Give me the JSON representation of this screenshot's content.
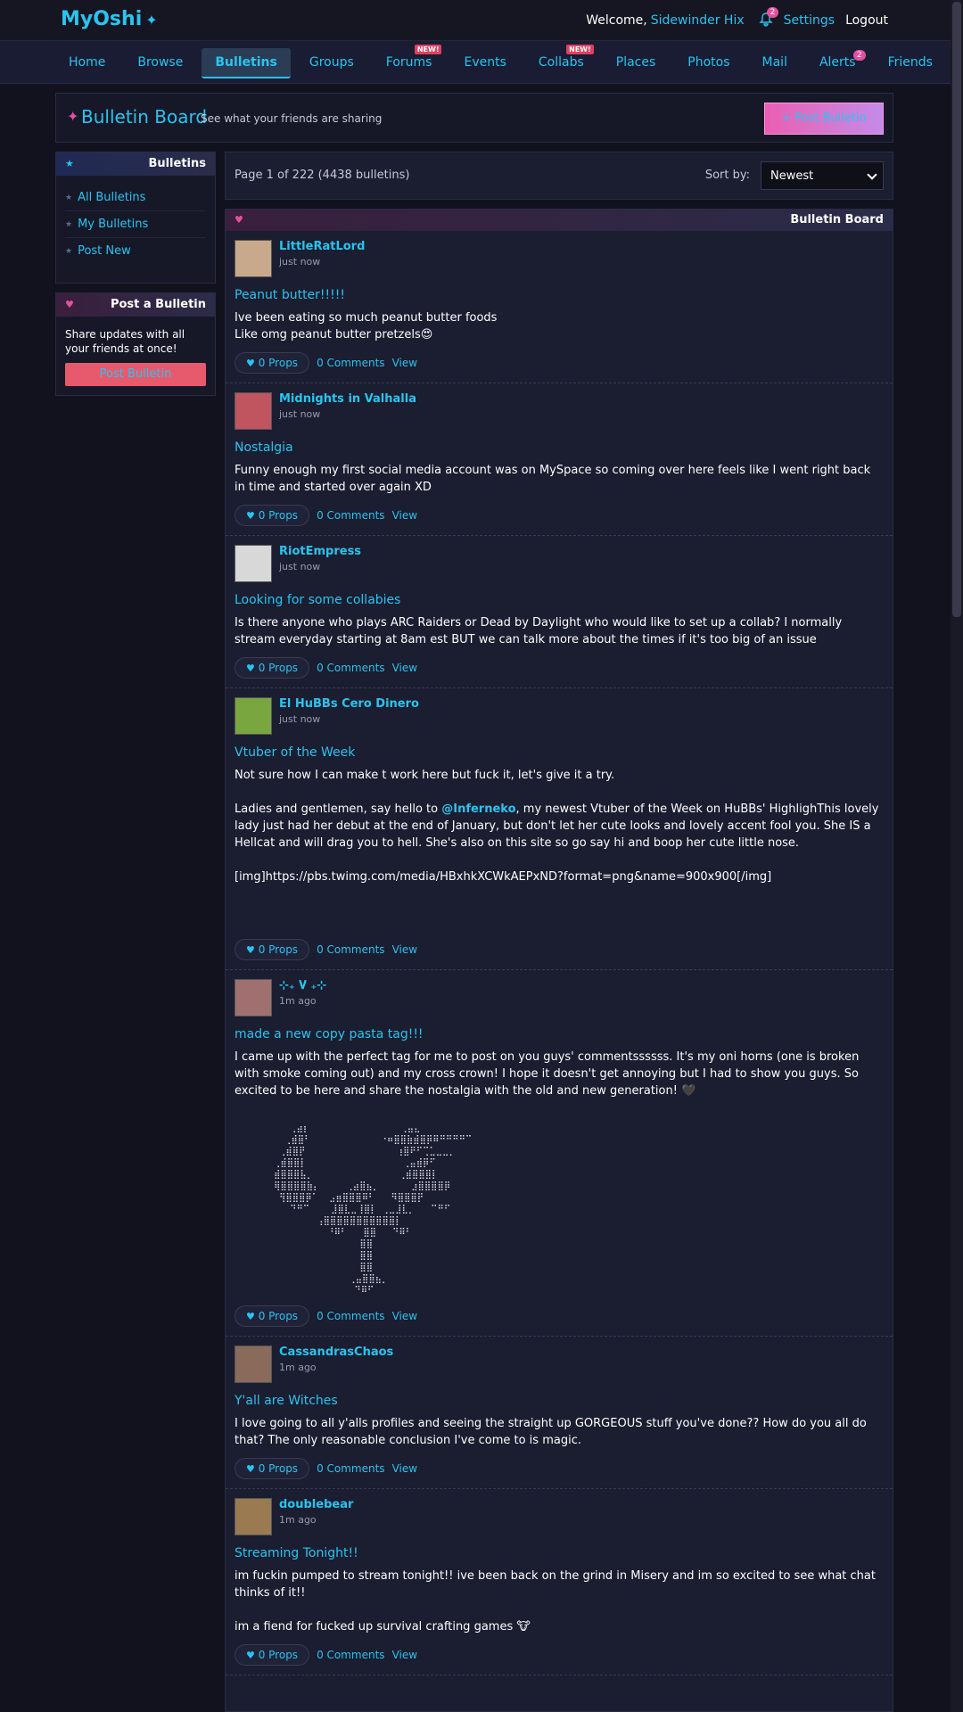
{
  "topbar": {
    "logo": "MyOshi",
    "logo_star": "✦",
    "welcome": "Welcome,",
    "username": "Sidewinder Hix",
    "bell_count": "2",
    "settings": "Settings",
    "logout": "Logout"
  },
  "nav": [
    {
      "label": "Home"
    },
    {
      "label": "Browse"
    },
    {
      "label": "Bulletins",
      "active": true
    },
    {
      "label": "Groups"
    },
    {
      "label": "Forums",
      "badge_new": "NEW!"
    },
    {
      "label": "Events"
    },
    {
      "label": "Collabs",
      "badge_new": "NEW!"
    },
    {
      "label": "Places"
    },
    {
      "label": "Photos"
    },
    {
      "label": "Mail"
    },
    {
      "label": "Alerts",
      "badge_count": "2"
    },
    {
      "label": "Friends"
    }
  ],
  "header": {
    "title": "Bulletin Board",
    "subtitle": "See what your friends are sharing",
    "post_button": "+ Post Bulletin"
  },
  "sidebar": {
    "bulletins_title": "Bulletins",
    "links": [
      "All Bulletins",
      "My Bulletins",
      "Post New"
    ],
    "post_title": "Post a Bulletin",
    "post_text": "Share updates with all your friends at once!",
    "post_button": "Post Bulletin"
  },
  "pagebar": {
    "info": "Page 1 of 222 (4438 bulletins)",
    "sort_label": "Sort by:",
    "sort_value": "Newest"
  },
  "feed_title": "Bulletin Board",
  "actions": {
    "props": "0 Props",
    "comments": "0 Comments",
    "view": "View"
  },
  "posts": [
    {
      "author": "LittleRatLord",
      "time": "just now",
      "title": "Peanut butter!!!!!",
      "body": "Ive been eating so much peanut butter foods\nLike omg peanut butter pretzels😍",
      "avatar_color": "#c9a98c"
    },
    {
      "author": "Midnights in Valhalla",
      "time": "just now",
      "title": "Nostalgia",
      "body": "Funny enough my first social media account was on MySpace so coming over here feels like I went right back in time and started over again XD",
      "avatar_color": "#c05560"
    },
    {
      "author": "RiotEmpress",
      "time": "just now",
      "title": "Looking for some collabies",
      "body": "Is there anyone who plays ARC Raiders or Dead by Daylight who would like to set up a collab? I normally stream everyday starting at 8am est BUT we can talk more about the times if it's too big of an issue",
      "avatar_color": "#d8d8d8"
    },
    {
      "author": "El HuBBs Cero Dinero",
      "time": "just now",
      "title": "Vtuber of the Week",
      "body_pre": "Not sure how I can make t work here but fuck it, let's give it a try.\n\nLadies and gentlemen, say hello to ",
      "mention": "@Inferneko",
      "body_post": ", my newest Vtuber of the Week on HuBBs' HighlighThis lovely lady just had her debut at the end of January, but don't let her cute looks and lovely accent fool you. She IS a Hellcat and will drag you to hell. She's also on this site so go say hi and boop her cute little nose.\n\n[img]https://pbs.twimg.com/media/HBxhkXCWkAEPxND?format=png&name=900x900[/img]",
      "avatar_color": "#7aa640"
    },
    {
      "author": "⊹₊ 𝐕 ₊⊹",
      "time": "1m ago",
      "title": "made a new copy pasta tag!!!",
      "body": "I came up with the perfect tag for me to post on you guys' commentssssss. It's my oni horns (one is broken with smoke coming out) and my cross crown! I hope it doesn't get annoying but I had to show you guys. So excited to be here and share the nostalgia with the old and new generation! 🖤",
      "ascii": "       ⢀⣴⡆                 ⢀⣤⣄\n      ⢀⣾⣿⠃             ⠐⠶⣿⣿⣷⣾⣿⡿⠿⠛⠛⠛⠛⠉\n     ⢀⣾⣿⡟                 ⢰⣿⠟⠋⢉⣁⣀⣀⡀\n    ⢀⣾⣿⣿⡇                  ⢀⣤⣾⡿⠋\n    ⣾⣿⣿⣿⣧⡀                ⢀⣾⣿⣿⣿⡇\n    ⢿⣿⣿⣿⣿⣷⡄     ⢀⣴⣿⣦⡀      ⣰⣿⣿⣿⣿⡿\n     ⢻⣿⣿⣿⡿⠁  ⣠⣶⣿⣿⣿⠿⠃   ⠻⣿⣿⣿⡟\n       ⠙⠛⠉    ⣸⣿⣇⣀⢸⣿⡇ ⢀⣀⣸⣇⡀   ⠉⠛⠋\n            ⢠⣿⣿⣿⣿⣿⣿⣿⣿⣿⣿⣿⡇\n              ⠘⠿⠃   ⣿⣿   ⠙⠿⠃\n                    ⣿⣿\n                    ⣿⣿\n                    ⣿⣿\n                  ⢀⣤⣿⣿⣦⡀\n                   ⠙⠿⠋",
      "avatar_color": "#a07070"
    },
    {
      "author": "CassandrasChaos",
      "time": "1m ago",
      "title": "Y'all are Witches",
      "body": "I love going to all y'alls profiles and seeing the straight up GORGEOUS stuff you've done?? How do you all do that? The only reasonable conclusion I've come to is magic.",
      "avatar_color": "#8a6a5a"
    },
    {
      "author": "doublebear",
      "time": "1m ago",
      "title": "Streaming Tonight!!",
      "body": "im fuckin pumped to stream tonight!! ive been back on the grind in Misery and im so excited to see what chat thinks of it!!\n\nim a fiend for fucked up survival crafting games 🐮",
      "avatar_color": "#9a7a50"
    }
  ]
}
